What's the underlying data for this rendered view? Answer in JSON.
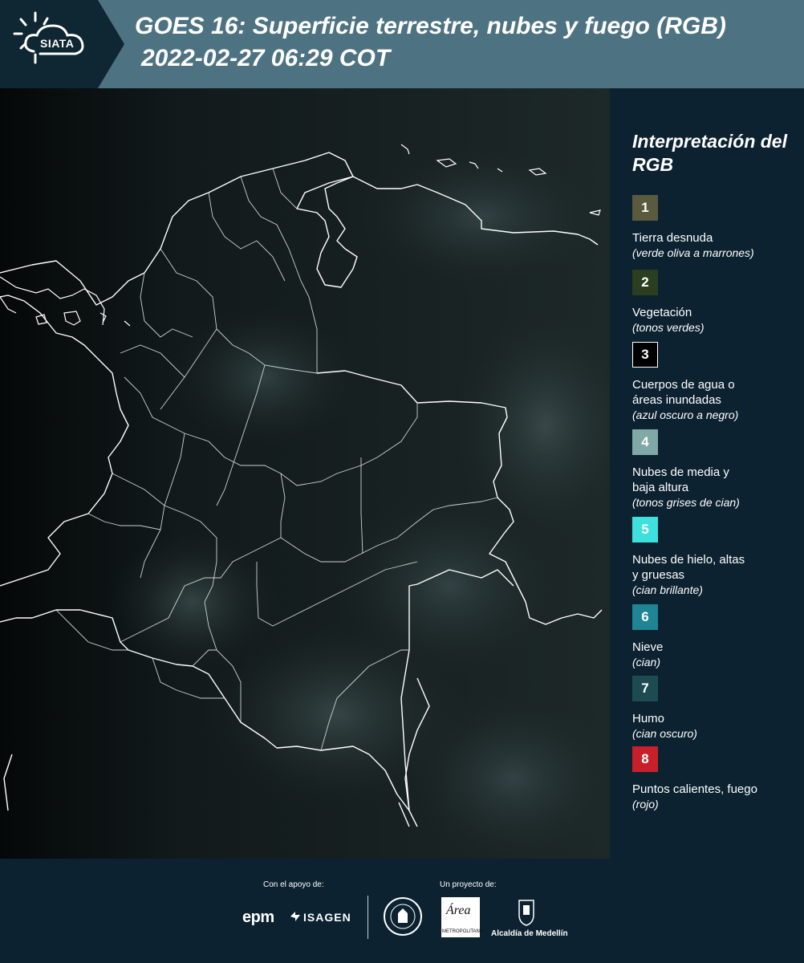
{
  "header": {
    "logo_text": "SIATA",
    "title": "GOES 16: Superficie terrestre, nubes y fuego (RGB)",
    "timestamp": "2022-02-27 06:29 COT"
  },
  "map": {
    "description_icon": "satellite-rgb-map",
    "boundary_color": "#ffffff"
  },
  "legend": {
    "title": "Interpretación del RGB",
    "items": [
      {
        "num": "1",
        "label": "Tierra desnuda",
        "sub": "(verde oliva a marrones)",
        "color": "#5a5a3e"
      },
      {
        "num": "2",
        "label": "Vegetación",
        "sub": "(tonos verdes)",
        "color": "#2b3e1f"
      },
      {
        "num": "3",
        "label": "Cuerpos de agua o áreas inundadas",
        "sub": "(azul oscuro a negro)",
        "color": "#000000"
      },
      {
        "num": "4",
        "label": "Nubes de media y baja altura",
        "sub": "(tonos grises de cian)",
        "color": "#7fa8a6"
      },
      {
        "num": "5",
        "label": "Nubes de hielo, altas y gruesas",
        "sub": "(cian brillante)",
        "color": "#3ee0de"
      },
      {
        "num": "6",
        "label": "Nieve",
        "sub": "(cian)",
        "color": "#1f8494"
      },
      {
        "num": "7",
        "label": "Humo",
        "sub": "(cian oscuro)",
        "color": "#1c4c52"
      },
      {
        "num": "8",
        "label": "Puntos calientes, fuego",
        "sub": "(rojo)",
        "color": "#c8202a"
      }
    ]
  },
  "footer": {
    "support_label": "Con el apoyo de:",
    "project_label": "Un proyecto de:",
    "epm": "epm",
    "isagen": "ISAGEN",
    "area_script": "Área",
    "area_small": "METROPOLITANA",
    "alcaldia": "Alcaldía de Medellín"
  }
}
